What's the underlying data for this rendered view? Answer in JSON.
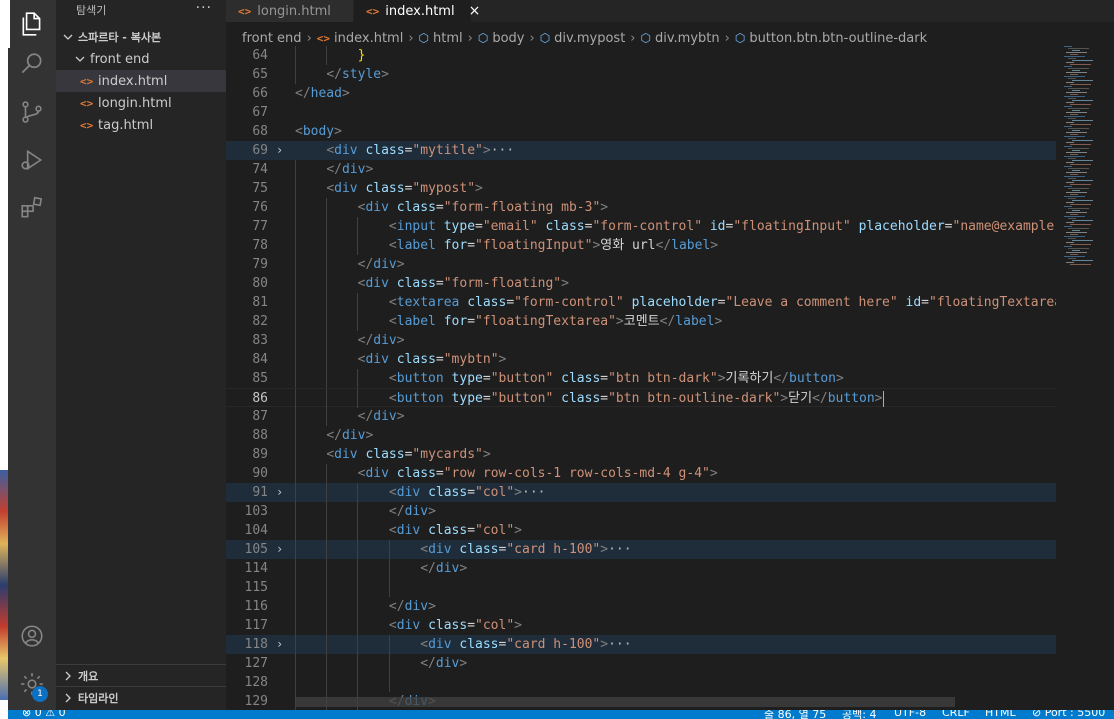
{
  "colors": {
    "activity_bar": "#333333",
    "sidebar": "#252526",
    "editor": "#1e1e1e",
    "statusbar": "#007acc",
    "tag": "#569cd6",
    "attribute": "#9cdcfe",
    "string": "#ce9178"
  },
  "activity_icons": [
    "explorer-icon",
    "search-icon",
    "source-control-icon",
    "run-debug-icon",
    "extensions-icon",
    "account-icon",
    "manage-gear-icon"
  ],
  "manage_badge": "1",
  "sidebar": {
    "title": "탐색기",
    "more": "···",
    "folder": "스파르타 - 복사본",
    "subfolder": "front end",
    "files": [
      {
        "name": "index.html",
        "icon": "<>"
      },
      {
        "name": "longin.html",
        "icon": "<>"
      },
      {
        "name": "tag.html",
        "icon": "<>"
      }
    ],
    "outline_label": "개요",
    "timeline_label": "타임라인"
  },
  "tabs": [
    {
      "label": "longin.html",
      "icon": "<>"
    },
    {
      "label": "index.html",
      "icon": "<>",
      "close": "×"
    }
  ],
  "breadcrumb": [
    "front end",
    "index.html",
    "html",
    "body",
    "div.mypost",
    "div.mybtn",
    "button.btn.btn-outline-dark"
  ],
  "editor": {
    "lines": [
      {
        "n": "64",
        "depth": 2,
        "tokens": [
          [
            "        ",
            "tx"
          ],
          [
            "}",
            "br"
          ]
        ]
      },
      {
        "n": "65",
        "depth": 1,
        "tokens": [
          [
            "    ",
            "tx"
          ],
          [
            "</",
            "p"
          ],
          [
            "style",
            "t"
          ],
          [
            ">",
            "p"
          ]
        ]
      },
      {
        "n": "66",
        "depth": 0,
        "tokens": [
          [
            "</",
            "p"
          ],
          [
            "head",
            "t"
          ],
          [
            ">",
            "p"
          ]
        ]
      },
      {
        "n": "67",
        "depth": 0,
        "tokens": []
      },
      {
        "n": "68",
        "depth": 0,
        "tokens": [
          [
            "<",
            "p"
          ],
          [
            "body",
            "t"
          ],
          [
            ">",
            "p"
          ]
        ]
      },
      {
        "n": "69",
        "depth": 0,
        "fold": true,
        "hl": true,
        "tokens": [
          [
            "    ",
            "tx"
          ],
          [
            "<",
            "p"
          ],
          [
            "div",
            "t"
          ],
          [
            " ",
            "tx"
          ],
          [
            "class",
            "a"
          ],
          [
            "=",
            "tx"
          ],
          [
            "\"mytitle\"",
            "s"
          ],
          [
            ">",
            "p"
          ],
          [
            "···",
            "ell"
          ]
        ]
      },
      {
        "n": "74",
        "depth": 1,
        "tokens": [
          [
            "    ",
            "tx"
          ],
          [
            "</",
            "p"
          ],
          [
            "div",
            "t"
          ],
          [
            ">",
            "p"
          ]
        ]
      },
      {
        "n": "75",
        "depth": 1,
        "tokens": [
          [
            "    ",
            "tx"
          ],
          [
            "<",
            "p"
          ],
          [
            "div",
            "t"
          ],
          [
            " ",
            "tx"
          ],
          [
            "class",
            "a"
          ],
          [
            "=",
            "tx"
          ],
          [
            "\"mypost\"",
            "s"
          ],
          [
            ">",
            "p"
          ]
        ]
      },
      {
        "n": "76",
        "depth": 2,
        "tokens": [
          [
            "        ",
            "tx"
          ],
          [
            "<",
            "p"
          ],
          [
            "div",
            "t"
          ],
          [
            " ",
            "tx"
          ],
          [
            "class",
            "a"
          ],
          [
            "=",
            "tx"
          ],
          [
            "\"form-floating mb-3\"",
            "s"
          ],
          [
            ">",
            "p"
          ]
        ]
      },
      {
        "n": "77",
        "depth": 3,
        "tokens": [
          [
            "            ",
            "tx"
          ],
          [
            "<",
            "p"
          ],
          [
            "input",
            "t"
          ],
          [
            " ",
            "tx"
          ],
          [
            "type",
            "a"
          ],
          [
            "=",
            "tx"
          ],
          [
            "\"email\"",
            "s"
          ],
          [
            " ",
            "tx"
          ],
          [
            "class",
            "a"
          ],
          [
            "=",
            "tx"
          ],
          [
            "\"form-control\"",
            "s"
          ],
          [
            " ",
            "tx"
          ],
          [
            "id",
            "a"
          ],
          [
            "=",
            "tx"
          ],
          [
            "\"floatingInput\"",
            "s"
          ],
          [
            " ",
            "tx"
          ],
          [
            "placeholder",
            "a"
          ],
          [
            "=",
            "tx"
          ],
          [
            "\"name@example.co",
            "s"
          ]
        ]
      },
      {
        "n": "78",
        "depth": 3,
        "tokens": [
          [
            "            ",
            "tx"
          ],
          [
            "<",
            "p"
          ],
          [
            "label",
            "t"
          ],
          [
            " ",
            "tx"
          ],
          [
            "for",
            "a"
          ],
          [
            "=",
            "tx"
          ],
          [
            "\"floatingInput\"",
            "s"
          ],
          [
            ">",
            "p"
          ],
          [
            "영화 url",
            "tx"
          ],
          [
            "</",
            "p"
          ],
          [
            "label",
            "t"
          ],
          [
            ">",
            "p"
          ]
        ]
      },
      {
        "n": "79",
        "depth": 2,
        "tokens": [
          [
            "        ",
            "tx"
          ],
          [
            "</",
            "p"
          ],
          [
            "div",
            "t"
          ],
          [
            ">",
            "p"
          ]
        ]
      },
      {
        "n": "80",
        "depth": 2,
        "tokens": [
          [
            "        ",
            "tx"
          ],
          [
            "<",
            "p"
          ],
          [
            "div",
            "t"
          ],
          [
            " ",
            "tx"
          ],
          [
            "class",
            "a"
          ],
          [
            "=",
            "tx"
          ],
          [
            "\"form-floating\"",
            "s"
          ],
          [
            ">",
            "p"
          ]
        ]
      },
      {
        "n": "81",
        "depth": 3,
        "tokens": [
          [
            "            ",
            "tx"
          ],
          [
            "<",
            "p"
          ],
          [
            "textarea",
            "t"
          ],
          [
            " ",
            "tx"
          ],
          [
            "class",
            "a"
          ],
          [
            "=",
            "tx"
          ],
          [
            "\"form-control\"",
            "s"
          ],
          [
            " ",
            "tx"
          ],
          [
            "placeholder",
            "a"
          ],
          [
            "=",
            "tx"
          ],
          [
            "\"Leave a comment here\"",
            "s"
          ],
          [
            " ",
            "tx"
          ],
          [
            "id",
            "a"
          ],
          [
            "=",
            "tx"
          ],
          [
            "\"floatingTextarea\"",
            "s"
          ]
        ]
      },
      {
        "n": "82",
        "depth": 3,
        "tokens": [
          [
            "            ",
            "tx"
          ],
          [
            "<",
            "p"
          ],
          [
            "label",
            "t"
          ],
          [
            " ",
            "tx"
          ],
          [
            "for",
            "a"
          ],
          [
            "=",
            "tx"
          ],
          [
            "\"floatingTextarea\"",
            "s"
          ],
          [
            ">",
            "p"
          ],
          [
            "코멘트",
            "tx"
          ],
          [
            "</",
            "p"
          ],
          [
            "label",
            "t"
          ],
          [
            ">",
            "p"
          ]
        ]
      },
      {
        "n": "83",
        "depth": 2,
        "tokens": [
          [
            "        ",
            "tx"
          ],
          [
            "</",
            "p"
          ],
          [
            "div",
            "t"
          ],
          [
            ">",
            "p"
          ]
        ]
      },
      {
        "n": "84",
        "depth": 2,
        "tokens": [
          [
            "        ",
            "tx"
          ],
          [
            "<",
            "p"
          ],
          [
            "div",
            "t"
          ],
          [
            " ",
            "tx"
          ],
          [
            "class",
            "a"
          ],
          [
            "=",
            "tx"
          ],
          [
            "\"mybtn\"",
            "s"
          ],
          [
            ">",
            "p"
          ]
        ]
      },
      {
        "n": "85",
        "depth": 3,
        "tokens": [
          [
            "            ",
            "tx"
          ],
          [
            "<",
            "p"
          ],
          [
            "button",
            "t"
          ],
          [
            " ",
            "tx"
          ],
          [
            "type",
            "a"
          ],
          [
            "=",
            "tx"
          ],
          [
            "\"button\"",
            "s"
          ],
          [
            " ",
            "tx"
          ],
          [
            "class",
            "a"
          ],
          [
            "=",
            "tx"
          ],
          [
            "\"btn btn-dark\"",
            "s"
          ],
          [
            ">",
            "p"
          ],
          [
            "기록하기",
            "tx"
          ],
          [
            "</",
            "p"
          ],
          [
            "button",
            "t"
          ],
          [
            ">",
            "p"
          ]
        ]
      },
      {
        "n": "86",
        "depth": 3,
        "cur": true,
        "tokens": [
          [
            "            ",
            "tx"
          ],
          [
            "<",
            "p"
          ],
          [
            "button",
            "t"
          ],
          [
            " ",
            "tx"
          ],
          [
            "type",
            "a"
          ],
          [
            "=",
            "tx"
          ],
          [
            "\"button\"",
            "s"
          ],
          [
            " ",
            "tx"
          ],
          [
            "class",
            "a"
          ],
          [
            "=",
            "tx"
          ],
          [
            "\"btn btn-outline-dark\"",
            "s"
          ],
          [
            ">",
            "p"
          ],
          [
            "닫기",
            "tx"
          ],
          [
            "</",
            "p"
          ],
          [
            "button",
            "t"
          ],
          [
            ">",
            "p"
          ]
        ]
      },
      {
        "n": "87",
        "depth": 2,
        "tokens": [
          [
            "        ",
            "tx"
          ],
          [
            "</",
            "p"
          ],
          [
            "div",
            "t"
          ],
          [
            ">",
            "p"
          ]
        ]
      },
      {
        "n": "88",
        "depth": 1,
        "tokens": [
          [
            "    ",
            "tx"
          ],
          [
            "</",
            "p"
          ],
          [
            "div",
            "t"
          ],
          [
            ">",
            "p"
          ]
        ]
      },
      {
        "n": "89",
        "depth": 1,
        "tokens": [
          [
            "    ",
            "tx"
          ],
          [
            "<",
            "p"
          ],
          [
            "div",
            "t"
          ],
          [
            " ",
            "tx"
          ],
          [
            "class",
            "a"
          ],
          [
            "=",
            "tx"
          ],
          [
            "\"mycards\"",
            "s"
          ],
          [
            ">",
            "p"
          ]
        ]
      },
      {
        "n": "90",
        "depth": 2,
        "tokens": [
          [
            "        ",
            "tx"
          ],
          [
            "<",
            "p"
          ],
          [
            "div",
            "t"
          ],
          [
            " ",
            "tx"
          ],
          [
            "class",
            "a"
          ],
          [
            "=",
            "tx"
          ],
          [
            "\"row row-cols-1 row-cols-md-4 g-4\"",
            "s"
          ],
          [
            ">",
            "p"
          ]
        ]
      },
      {
        "n": "91",
        "depth": 3,
        "fold": true,
        "hl": true,
        "tokens": [
          [
            "            ",
            "tx"
          ],
          [
            "<",
            "p"
          ],
          [
            "div",
            "t"
          ],
          [
            " ",
            "tx"
          ],
          [
            "class",
            "a"
          ],
          [
            "=",
            "tx"
          ],
          [
            "\"col\"",
            "s"
          ],
          [
            ">",
            "p"
          ],
          [
            "···",
            "ell"
          ]
        ]
      },
      {
        "n": "103",
        "depth": 3,
        "tokens": [
          [
            "            ",
            "tx"
          ],
          [
            "</",
            "p"
          ],
          [
            "div",
            "t"
          ],
          [
            ">",
            "p"
          ]
        ]
      },
      {
        "n": "104",
        "depth": 3,
        "tokens": [
          [
            "            ",
            "tx"
          ],
          [
            "<",
            "p"
          ],
          [
            "div",
            "t"
          ],
          [
            " ",
            "tx"
          ],
          [
            "class",
            "a"
          ],
          [
            "=",
            "tx"
          ],
          [
            "\"col\"",
            "s"
          ],
          [
            ">",
            "p"
          ]
        ]
      },
      {
        "n": "105",
        "depth": 4,
        "fold": true,
        "hl": true,
        "tokens": [
          [
            "                ",
            "tx"
          ],
          [
            "<",
            "p"
          ],
          [
            "div",
            "t"
          ],
          [
            " ",
            "tx"
          ],
          [
            "class",
            "a"
          ],
          [
            "=",
            "tx"
          ],
          [
            "\"card h-100\"",
            "s"
          ],
          [
            ">",
            "p"
          ],
          [
            "···",
            "ell"
          ]
        ]
      },
      {
        "n": "114",
        "depth": 4,
        "tokens": [
          [
            "                ",
            "tx"
          ],
          [
            "</",
            "p"
          ],
          [
            "div",
            "t"
          ],
          [
            ">",
            "p"
          ]
        ]
      },
      {
        "n": "115",
        "depth": 4,
        "tokens": []
      },
      {
        "n": "116",
        "depth": 3,
        "tokens": [
          [
            "            ",
            "tx"
          ],
          [
            "</",
            "p"
          ],
          [
            "div",
            "t"
          ],
          [
            ">",
            "p"
          ]
        ]
      },
      {
        "n": "117",
        "depth": 3,
        "tokens": [
          [
            "            ",
            "tx"
          ],
          [
            "<",
            "p"
          ],
          [
            "div",
            "t"
          ],
          [
            " ",
            "tx"
          ],
          [
            "class",
            "a"
          ],
          [
            "=",
            "tx"
          ],
          [
            "\"col\"",
            "s"
          ],
          [
            ">",
            "p"
          ]
        ]
      },
      {
        "n": "118",
        "depth": 4,
        "fold": true,
        "hl": true,
        "tokens": [
          [
            "                ",
            "tx"
          ],
          [
            "<",
            "p"
          ],
          [
            "div",
            "t"
          ],
          [
            " ",
            "tx"
          ],
          [
            "class",
            "a"
          ],
          [
            "=",
            "tx"
          ],
          [
            "\"card h-100\"",
            "s"
          ],
          [
            ">",
            "p"
          ],
          [
            "···",
            "ell"
          ]
        ]
      },
      {
        "n": "127",
        "depth": 4,
        "tokens": [
          [
            "                ",
            "tx"
          ],
          [
            "</",
            "p"
          ],
          [
            "div",
            "t"
          ],
          [
            ">",
            "p"
          ]
        ]
      },
      {
        "n": "128",
        "depth": 4,
        "tokens": []
      },
      {
        "n": "129",
        "depth": 3,
        "tokens": [
          [
            "            ",
            "tx"
          ],
          [
            "</",
            "p"
          ],
          [
            "div",
            "t"
          ],
          [
            ">",
            "p"
          ]
        ]
      }
    ]
  },
  "statusbar": {
    "problems": "⊗ 0 ⚠ 0",
    "position": "줄 86, 열 75",
    "spaces": "공백: 4",
    "encoding": "UTF-8",
    "eol": "CRLF",
    "language": "HTML",
    "port": "⊘ Port : 5500"
  }
}
